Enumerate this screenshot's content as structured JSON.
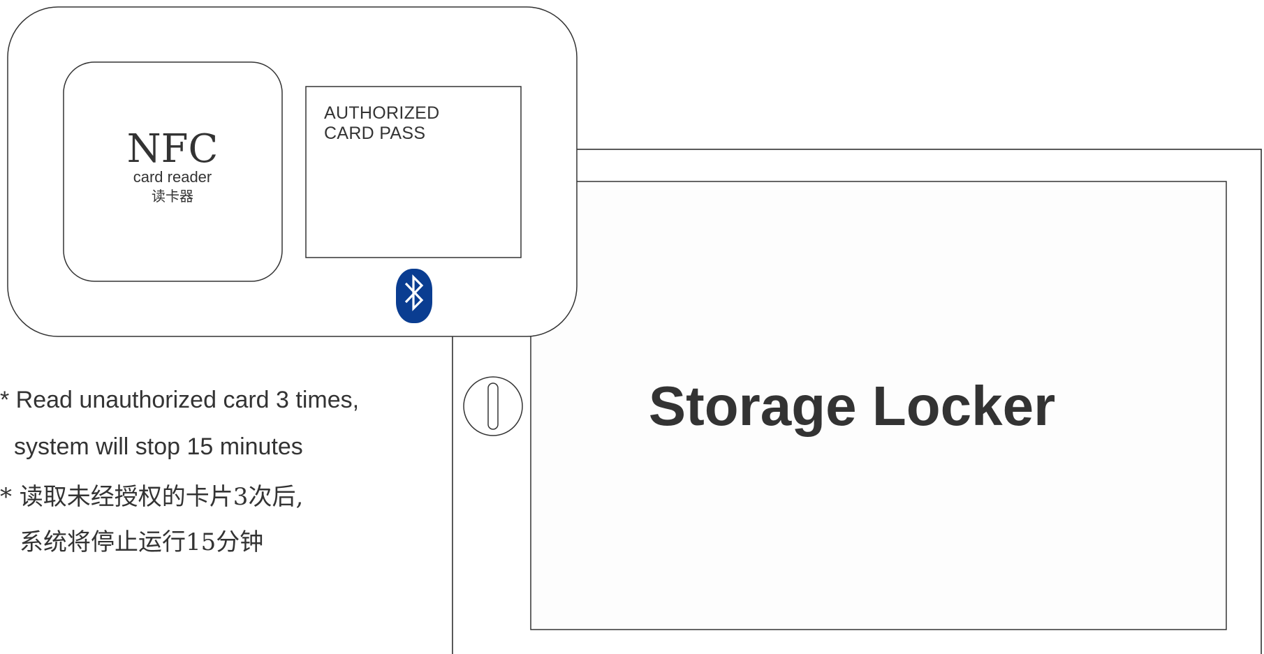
{
  "nfc_reader": {
    "title": "NFC",
    "subtitle": "card reader",
    "chinese_label": "读卡器"
  },
  "authorized_panel": {
    "line1": "AUTHORIZED",
    "line2": "CARD PASS"
  },
  "bluetooth": {
    "icon": "bluetooth-icon",
    "color": "#0a3d91"
  },
  "locker": {
    "title": "Storage Locker"
  },
  "notes": {
    "en_line1": "* Read unauthorized card 3 times,",
    "en_line2": "system will stop 15 minutes",
    "cn_line1": "* 读取未经授权的卡片3次后,",
    "cn_line2": "系统将停止运行15分钟"
  },
  "colors": {
    "stroke": "#333333",
    "panel_fill": "#fdfdfd",
    "bluetooth": "#0a3d91"
  }
}
